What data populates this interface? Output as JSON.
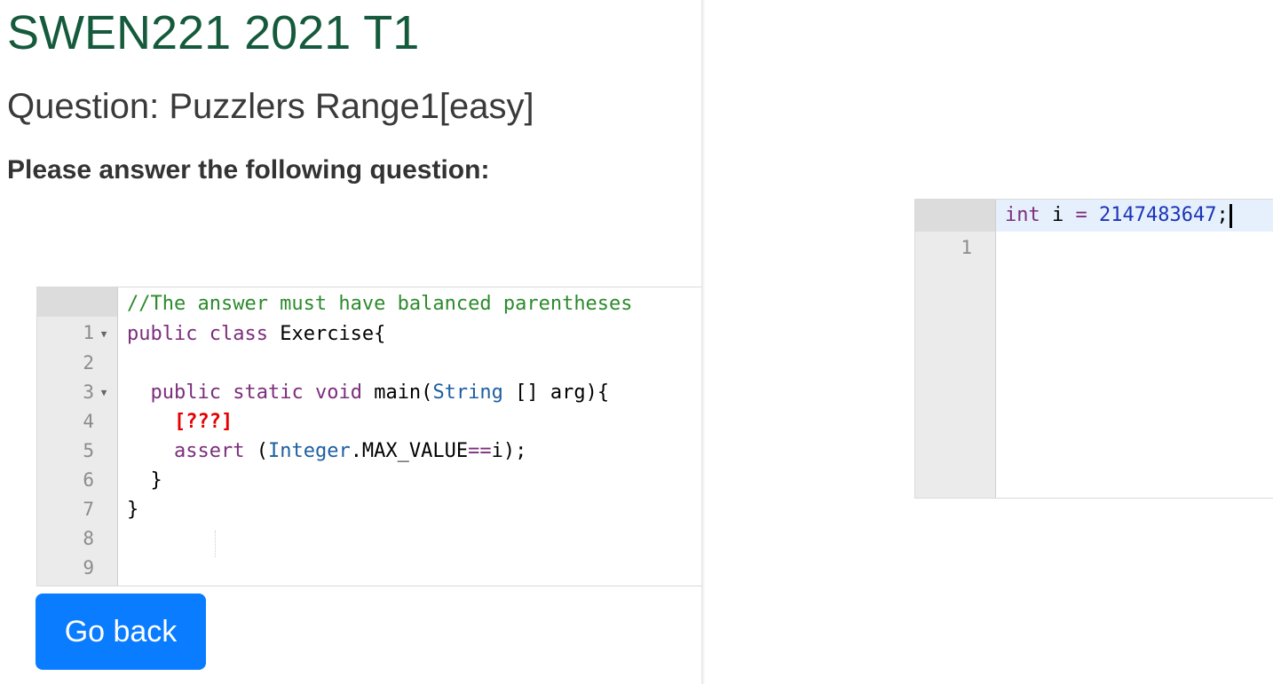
{
  "header": {
    "course": "SWEN221 2021 T1",
    "question": "Question: Puzzlers Range1[easy]",
    "instruction": "Please answer the following question:"
  },
  "question_editor": {
    "line_numbers": [
      "1",
      "2",
      "3",
      "4",
      "5",
      "6",
      "7",
      "8",
      "9"
    ],
    "lines": {
      "l1_comment": "//The answer must have balanced parentheses",
      "l2_kw1": "public",
      "l2_kw2": "class",
      "l2_rest": " Exercise{",
      "l4_kw1": "public",
      "l4_kw2": "static",
      "l4_kw3": "void",
      "l4_name": " main(",
      "l4_type": "String",
      "l4_rest": " [] arg){",
      "l5_placeholder": "[???]",
      "l6_kw": "assert",
      "l6_open": " (",
      "l6_type": "Integer",
      "l6_mid": ".MAX_VALUE",
      "l6_op": "==",
      "l6_end": "i);",
      "l7": "}",
      "l8": "}"
    }
  },
  "answer_editor": {
    "line_numbers": [
      "1"
    ],
    "kw": "int",
    "ident": " i ",
    "op": "=",
    "num": "2147483647",
    "semi": ";"
  },
  "buttons": {
    "go_back": "Go back"
  },
  "colors": {
    "title": "#155a3c",
    "button": "#0a7cff",
    "keyword": "#7b2e7c",
    "type": "#1e5fa0",
    "comment": "#2c8a2c",
    "placeholder": "#e60000",
    "number": "#1a35b8"
  }
}
